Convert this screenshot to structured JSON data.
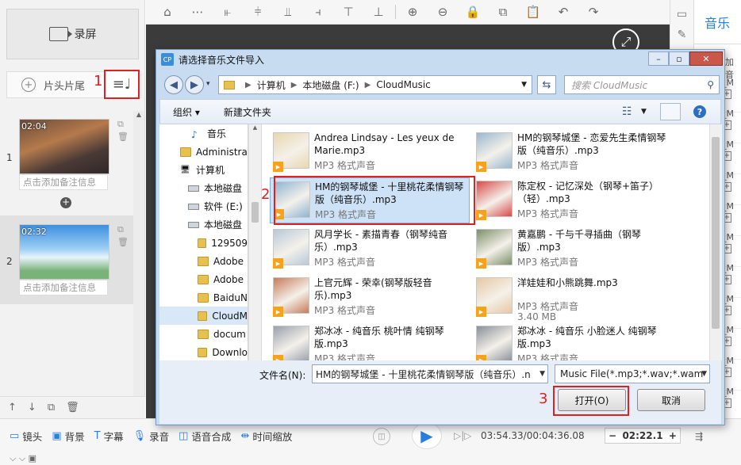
{
  "left": {
    "record_label": "录屏",
    "tab_label": "片头片尾",
    "clips": [
      {
        "index": "1",
        "time": "02:04",
        "note": "点击添加备注信息"
      },
      {
        "index": "2",
        "time": "02:32",
        "note": "点击添加备注信息"
      }
    ]
  },
  "annotations": {
    "step1": "1",
    "step2": "2",
    "step3": "3"
  },
  "right_panel": {
    "tab": "音乐",
    "add_label": "加音",
    "items": [
      "_M",
      "_M",
      "_M",
      "_M",
      "_M",
      "_M",
      "_M",
      "_M",
      "_M",
      "_M",
      "_M"
    ]
  },
  "bottom": {
    "items": [
      {
        "icon": "camera-icon",
        "label": "镜头"
      },
      {
        "icon": "image-icon",
        "label": "背景"
      },
      {
        "icon": "text-icon",
        "label": "字幕"
      },
      {
        "icon": "mic-icon",
        "label": "录音"
      },
      {
        "icon": "speech-icon",
        "label": "语音合成"
      },
      {
        "icon": "time-scale-icon",
        "label": "时间缩放"
      }
    ],
    "timecode": "03:54.33/00:04:36.08",
    "zoom_value": "02:22.1",
    "zoom_minus": "−",
    "zoom_plus": "+"
  },
  "dialog": {
    "title": "请选择音乐文件导入",
    "address": [
      "计算机",
      "本地磁盘 (F:)",
      "CloudMusic"
    ],
    "search_placeholder": "搜索 CloudMusic",
    "organize": "组织 ▾",
    "new_folder": "新建文件夹",
    "nav": [
      {
        "label": "音乐",
        "type": "music"
      },
      {
        "label": "Administra",
        "type": "folder"
      },
      {
        "label": "计算机",
        "type": "computer"
      },
      {
        "label": "本地磁盘",
        "type": "drive"
      },
      {
        "label": "软件 (E:)",
        "type": "drive"
      },
      {
        "label": "本地磁盘",
        "type": "drive"
      },
      {
        "label": "129509",
        "type": "folder"
      },
      {
        "label": "Adobe",
        "type": "folder"
      },
      {
        "label": "Adobe",
        "type": "folder"
      },
      {
        "label": "BaiduN",
        "type": "folder"
      },
      {
        "label": "CloudM",
        "type": "folder",
        "selected": true
      },
      {
        "label": "docum",
        "type": "folder"
      },
      {
        "label": "Downlo",
        "type": "folder"
      }
    ],
    "files": [
      {
        "name": "Andrea Lindsay - Les yeux de Marie.mp3",
        "meta": "MP3 格式声音",
        "color": "#e8d6b0"
      },
      {
        "name": "HM的钢琴城堡 - 恋爱先生柔情钢琴版（纯音乐）.mp3",
        "meta": "MP3 格式声音",
        "color": "#9ab7cf"
      },
      {
        "name": "HM的钢琴城堡 - 十里桃花柔情钢琴版（纯音乐）.mp3",
        "meta": "MP3 格式声音",
        "color": "#8fb3d1",
        "selected": true
      },
      {
        "name": "陈定权 - 记忆深处（钢琴+笛子）（轻）.mp3",
        "meta": "MP3 格式声音",
        "color": "#d94a4a"
      },
      {
        "name": "风月学长 - 素描青春（钢琴纯音乐）.mp3",
        "meta": "MP3 格式声音",
        "color": "#b9c8d8"
      },
      {
        "name": "黄嘉鹏 - 千与千寻插曲（钢琴版）.mp3",
        "meta": "MP3 格式声音",
        "color": "#7d8f6a"
      },
      {
        "name": "上官元辉 - 荣幸(钢琴版轻音乐).mp3",
        "meta": "MP3 格式声音",
        "color": "#c77b5a"
      },
      {
        "name": "洋娃娃和小熊跳舞.mp3",
        "meta": "MP3 格式声音",
        "size": "3.40 MB",
        "color": "#e7c7a4"
      },
      {
        "name": "郑冰冰 - 纯音乐 桃叶情 纯钢琴版.mp3",
        "meta": "MP3 格式声音",
        "color": "#9aa0ab"
      },
      {
        "name": "郑冰冰 - 纯音乐 小脸迷人 纯钢琴版.mp3",
        "meta": "MP3 格式声音",
        "color": "#8a8f99"
      }
    ],
    "filename_label": "文件名(N):",
    "filename_value": "HM的钢琴城堡 - 十里桃花柔情钢琴版（纯音乐）.n",
    "filetype_value": "Music File(*.mp3;*.wav;*.wam",
    "open_label": "打开(O)",
    "cancel_label": "取消"
  }
}
